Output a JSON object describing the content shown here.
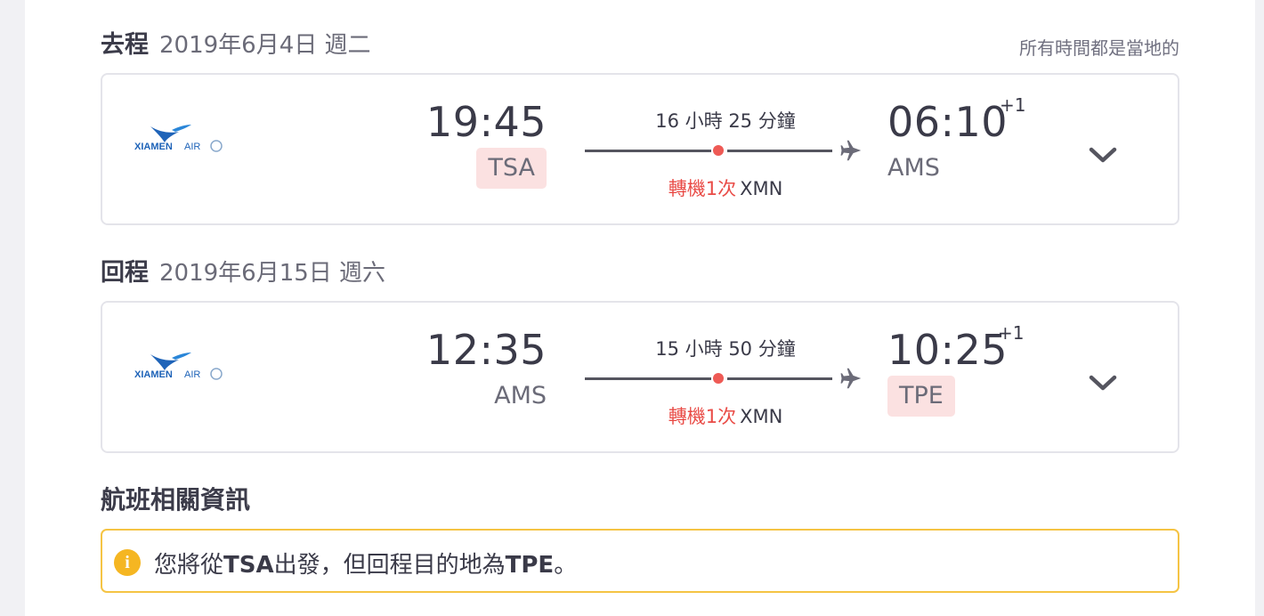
{
  "outbound": {
    "label": "去程",
    "date": "2019年6月4日 週二",
    "airline_logo": "XIAMENAIR",
    "dep_time": "19:45",
    "dep_code": "TSA",
    "duration": "16 小時 25 分鐘",
    "stops": "轉機1次",
    "via": "XMN",
    "arr_time": "06:10",
    "arr_day_offset": "+1",
    "arr_code": "AMS"
  },
  "local_time_note": "所有時間都是當地的",
  "inbound": {
    "label": "回程",
    "date": "2019年6月15日 週六",
    "airline_logo": "XIAMENAIR",
    "dep_time": "12:35",
    "dep_code": "AMS",
    "duration": "15 小時 50 分鐘",
    "stops": "轉機1次",
    "via": "XMN",
    "arr_time": "10:25",
    "arr_day_offset": "+1",
    "arr_code": "TPE"
  },
  "flight_info": {
    "title": "航班相關資訊",
    "notice": {
      "prefix": "您將從",
      "origin": "TSA",
      "middle": "出發，但回程目的地為",
      "destination": "TPE",
      "suffix": "。",
      "icon": "info-icon"
    }
  },
  "colors": {
    "highlight_bg": "#fbe1e1",
    "stop_red": "#e94b46",
    "warning_border": "#f5c444",
    "airline_blue": "#1e63b8"
  }
}
